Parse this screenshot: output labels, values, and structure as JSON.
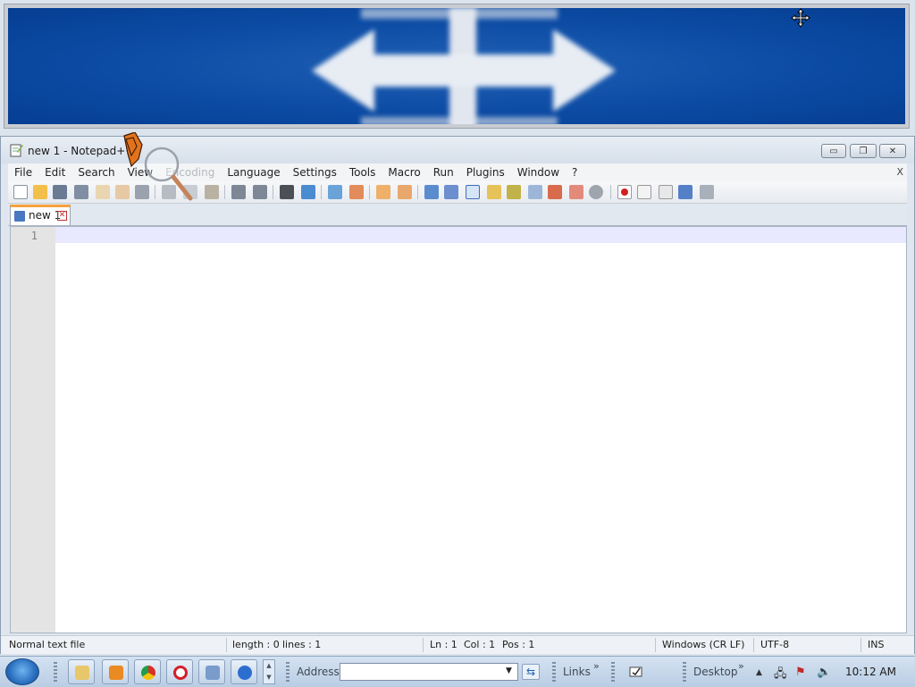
{
  "window": {
    "title": "new 1 - Notepad++"
  },
  "menu": {
    "items": [
      "File",
      "Edit",
      "Search",
      "View",
      "Encoding",
      "Language",
      "Settings",
      "Tools",
      "Macro",
      "Run",
      "Plugins",
      "Window",
      "?"
    ],
    "close_label": "X"
  },
  "toolbar": {
    "icons": [
      "new-file-icon",
      "open-file-icon",
      "save-icon",
      "save-all-icon",
      "close-icon",
      "close-all-icon",
      "print-icon",
      "cut-icon",
      "copy-icon",
      "paste-icon",
      "undo-icon",
      "redo-icon",
      "find-icon",
      "replace-icon",
      "zoom-in-icon",
      "zoom-out-icon",
      "sync-v-icon",
      "sync-h-icon",
      "word-wrap-icon",
      "show-all-chars-icon",
      "indent-guide-icon",
      "doc-map-icon",
      "function-list-icon",
      "folder-as-workspace-icon",
      "monitoring-icon",
      "record-macro-icon",
      "stop-macro-icon",
      "play-macro-icon",
      "run-multiple-macro-icon",
      "save-macro-icon"
    ]
  },
  "tabs": [
    {
      "label": "new 1"
    }
  ],
  "editor": {
    "line_numbers": [
      "1"
    ]
  },
  "status": {
    "file_type": "Normal text file",
    "length": "length : 0",
    "lines": "lines : 1",
    "ln": "Ln : 1",
    "col": "Col : 1",
    "pos": "Pos : 1",
    "eol": "Windows (CR LF)",
    "encoding": "UTF-8",
    "mode": "INS"
  },
  "taskbar": {
    "address_label": "Address",
    "address_value": "",
    "links_label": "Links",
    "chevron": "»",
    "desktop_label": "Desktop",
    "clock": "10:12 AM"
  },
  "colors": {
    "magnifier_bg": "#0b4aa3",
    "tab_accent": "#f6a23c",
    "current_line": "#e8e8ff",
    "gutter": "#e4e4e4"
  }
}
